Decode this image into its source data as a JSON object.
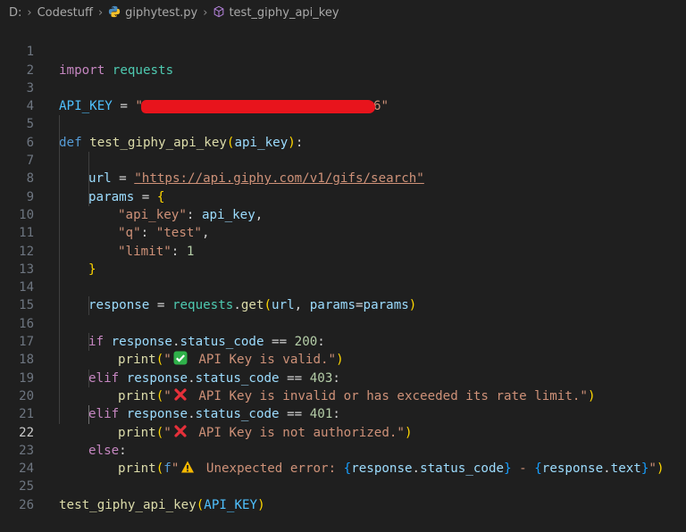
{
  "breadcrumb": {
    "drive": "D:",
    "folder": "Codestuff",
    "file": "giphytest.py",
    "symbol": "test_giphy_api_key"
  },
  "code": {
    "line_numbers": [
      "1",
      "2",
      "3",
      "4",
      "5",
      "6",
      "7",
      "8",
      "9",
      "10",
      "11",
      "12",
      "13",
      "14",
      "15",
      "16",
      "17",
      "18",
      "19",
      "20",
      "21",
      "22",
      "23",
      "24",
      "25",
      "26"
    ],
    "active_line": "22",
    "l1_import": "import",
    "l1_module": "requests",
    "l3_name": "API_KEY",
    "l3_eq": " = ",
    "l3_open_quote": "\"",
    "l3_tail": "6\"",
    "l5_def": "def",
    "l5_fname": "test_giphy_api_key",
    "l5_param": "api_key",
    "l6_var": "url",
    "l6_url": "\"https://api.giphy.com/v1/gifs/search\"",
    "l7_var": "params",
    "l8_key": "\"api_key\"",
    "l8_val": "api_key",
    "l9_key": "\"q\"",
    "l9_val": "\"test\"",
    "l10_key": "\"limit\"",
    "l10_val": "1",
    "l13_var": "response",
    "l13_mod": "requests",
    "l13_fn": "get",
    "l13_arg1": "url",
    "l13_kw": "params",
    "l13_kwval": "params",
    "l15_if": "if",
    "l15_obj": "response",
    "l15_attr": "status_code",
    "l15_num": "200",
    "print": "print",
    "l16_text": " API Key is valid.\"",
    "l17_elif": "elif",
    "l17_num": "403",
    "l18_text": " API Key is invalid or has exceeded its rate limit.\"",
    "l19_num": "401",
    "l20_text": " API Key is not authorized.\"",
    "l21_else": "else",
    "l22_f": "f",
    "l22_text": " Unexpected error: ",
    "l22_dash": " - ",
    "l22_text_attr": "text",
    "l25_call": "test_giphy_api_key",
    "l25_arg": "API_KEY",
    "quote": "\""
  }
}
